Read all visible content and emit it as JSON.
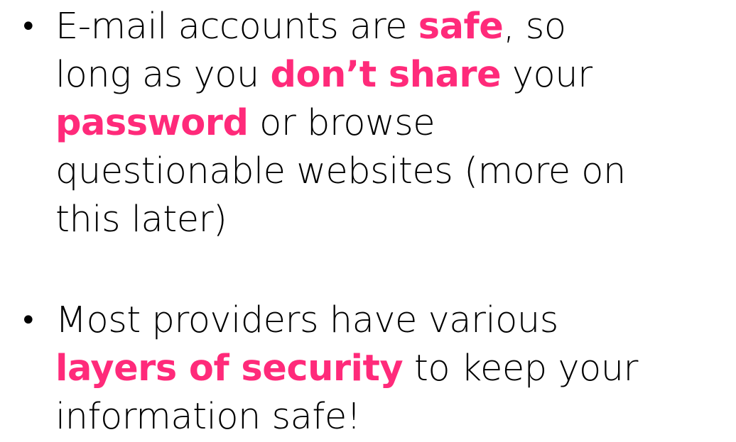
{
  "accent_color": "#ff2a7a",
  "bullet_glyph": "•",
  "bullets": [
    {
      "lines": [
        [
          {
            "t": "E-mail accounts are ",
            "hl": false
          },
          {
            "t": "safe",
            "hl": true
          },
          {
            "t": ", so",
            "hl": false
          }
        ],
        [
          {
            "t": "long as you ",
            "hl": false
          },
          {
            "t": "don’t share",
            "hl": true
          },
          {
            "t": " your",
            "hl": false
          }
        ],
        [
          {
            "t": "password",
            "hl": true
          },
          {
            "t": " or browse",
            "hl": false
          }
        ],
        [
          {
            "t": "questionable websites (more on",
            "hl": false
          }
        ],
        [
          {
            "t": "this later)",
            "hl": false
          }
        ]
      ]
    },
    {
      "lines": [
        [
          {
            "t": "Most providers have various",
            "hl": false
          }
        ],
        [
          {
            "t": "layers of security",
            "hl": true
          },
          {
            "t": " to keep your",
            "hl": false
          }
        ],
        [
          {
            "t": "information safe!",
            "hl": false
          }
        ]
      ]
    }
  ]
}
